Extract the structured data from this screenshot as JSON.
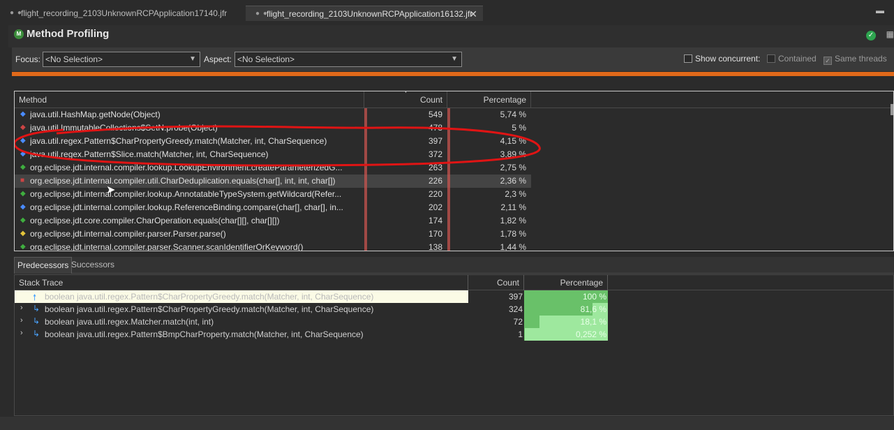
{
  "tabs": [
    {
      "label": "flight_recording_2103UnknownRCPApplication17140.jfr",
      "active": false
    },
    {
      "label": "flight_recording_2103UnknownRCPApplication16132.jfr",
      "active": true
    }
  ],
  "page": {
    "title": "Method Profiling"
  },
  "filter": {
    "focus_label": "Focus:",
    "focus_value": "<No Selection>",
    "aspect_label": "Aspect:",
    "aspect_value": "<No Selection>",
    "show_concurrent": "Show concurrent:",
    "contained": "Contained",
    "same_threads": "Same threads"
  },
  "method_table": {
    "headers": {
      "method": "Method",
      "count": "Count",
      "percentage": "Percentage"
    },
    "rows": [
      {
        "name": "java.util.HashMap.getNode(Object)",
        "count": "549",
        "pct": "5,74 %"
      },
      {
        "name": "java.util.ImmutableCollections$SetN.probe(Object)",
        "count": "478",
        "pct": "5 %"
      },
      {
        "name": "java.util.regex.Pattern$CharPropertyGreedy.match(Matcher, int, CharSequence)",
        "count": "397",
        "pct": "4,15 %"
      },
      {
        "name": "java.util.regex.Pattern$Slice.match(Matcher, int, CharSequence)",
        "count": "372",
        "pct": "3,89 %"
      },
      {
        "name": "org.eclipse.jdt.internal.compiler.lookup.LookupEnvironment.createParameterizedG...",
        "count": "263",
        "pct": "2,75 %"
      },
      {
        "name": "org.eclipse.jdt.internal.compiler.util.CharDeduplication.equals(char[], int, int, char[])",
        "count": "226",
        "pct": "2,36 %"
      },
      {
        "name": "org.eclipse.jdt.internal.compiler.lookup.AnnotatableTypeSystem.getWildcard(Refer...",
        "count": "220",
        "pct": "2,3 %"
      },
      {
        "name": "org.eclipse.jdt.internal.compiler.lookup.ReferenceBinding.compare(char[], char[], in...",
        "count": "202",
        "pct": "2,11 %"
      },
      {
        "name": "org.eclipse.jdt.core.compiler.CharOperation.equals(char[][], char[][])",
        "count": "174",
        "pct": "1,82 %"
      },
      {
        "name": "org.eclipse.jdt.internal.compiler.parser.Parser.parse()",
        "count": "170",
        "pct": "1,78 %"
      },
      {
        "name": "org.eclipse.jdt.internal.compiler.parser.Scanner.scanIdentifierOrKeyword()",
        "count": "138",
        "pct": "1,44 %"
      }
    ]
  },
  "lower_tabs": {
    "predecessors": "Predecessors",
    "successors": "Successors"
  },
  "stack_table": {
    "headers": {
      "trace": "Stack Trace",
      "count": "Count",
      "percentage": "Percentage"
    },
    "rows": [
      {
        "name": "boolean java.util.regex.Pattern$CharPropertyGreedy.match(Matcher, int, CharSequence)",
        "count": "397",
        "pct": "100 %",
        "fraction": 1.0
      },
      {
        "name": "boolean java.util.regex.Pattern$CharPropertyGreedy.match(Matcher, int, CharSequence)",
        "count": "324",
        "pct": "81,6 %",
        "fraction": 0.816
      },
      {
        "name": "boolean java.util.regex.Matcher.match(int, int)",
        "count": "72",
        "pct": "18,1 %",
        "fraction": 0.181
      },
      {
        "name": "boolean java.util.regex.Pattern$BmpCharProperty.match(Matcher, int, CharSequence)",
        "count": "1",
        "pct": "0,252 %",
        "fraction": 0.00252
      }
    ]
  }
}
